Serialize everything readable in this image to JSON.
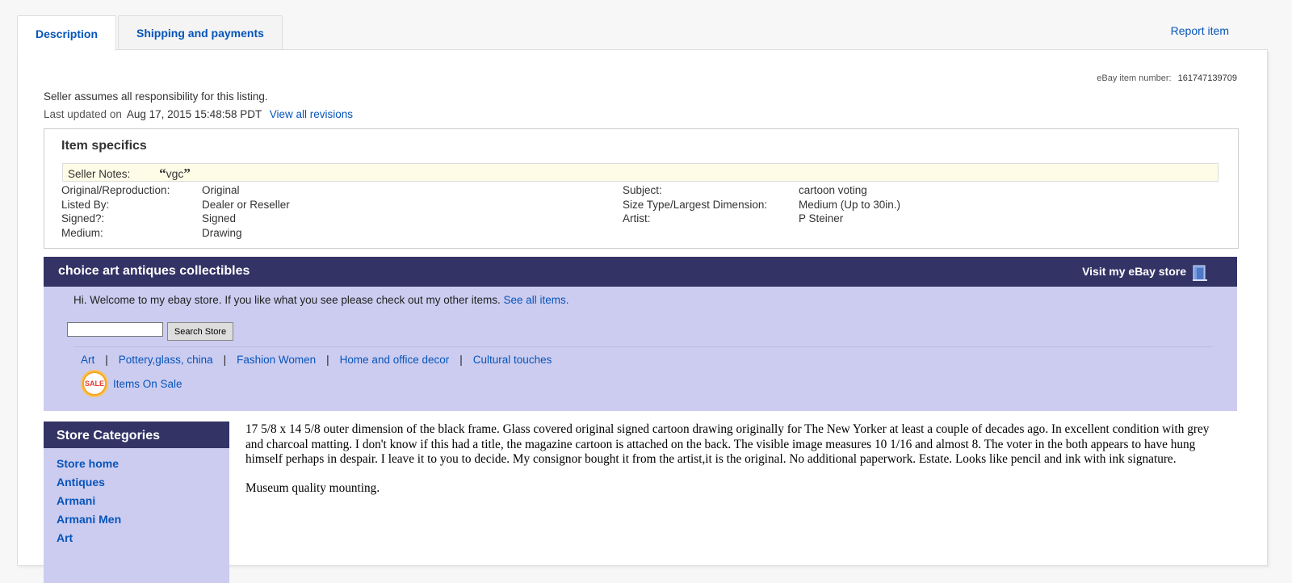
{
  "tabs": [
    {
      "label": "Description"
    },
    {
      "label": "Shipping and payments"
    }
  ],
  "report_label": "Report item",
  "item_number": {
    "label": "eBay item number:",
    "value": "161747139709"
  },
  "responsibility": "Seller assumes all responsibility for this listing.",
  "last_updated": {
    "label": "Last updated on",
    "value": "Aug 17, 2015 15:48:58 PDT",
    "link": "View all revisions"
  },
  "item_specifics": {
    "title": "Item specifics",
    "seller_notes": {
      "label": "Seller Notes:",
      "value": "vgc",
      "open_quote": "“",
      "close_quote": "”"
    },
    "left": [
      {
        "k": "Original/Reproduction:",
        "v": "Original"
      },
      {
        "k": "Listed By:",
        "v": "Dealer or Reseller"
      },
      {
        "k": "Signed?:",
        "v": "Signed"
      },
      {
        "k": "Medium:",
        "v": "Drawing"
      }
    ],
    "right": [
      {
        "k": "Subject:",
        "v": "cartoon voting"
      },
      {
        "k": "Size Type/Largest Dimension:",
        "v": "Medium (Up to 30in.)"
      },
      {
        "k": "Artist:",
        "v": "P Steiner"
      }
    ]
  },
  "store": {
    "name": "choice art antiques collectibles",
    "visit_label": "Visit my eBay store",
    "welcome": "Hi. Welcome to my ebay store. If you like what you see please check out my other items.",
    "see_all": "See all items.",
    "search_button": "Search Store",
    "search_value": "",
    "nav": [
      "Art",
      "Pottery,glass, china",
      "Fashion Women",
      "Home and office decor",
      "Cultural touches"
    ],
    "nav_separator": "|",
    "sale_badge": "SALE",
    "sale_label": "Items On Sale"
  },
  "store_categories": {
    "title": "Store Categories",
    "items": [
      "Store home",
      "Antiques",
      "Armani",
      "Armani Men",
      "Art"
    ]
  },
  "description": {
    "paragraphs": [
      "17 5/8 x 14 5/8 outer dimension of the black frame. Glass covered original signed cartoon drawing originally for The New Yorker at least a couple of decades ago. In excellent condition with grey and charcoal matting. I don't know if this had a title, the magazine cartoon is attached on the back. The visible image measures 10 1/16 and almost 8. The voter in the both appears to have hung himself perhaps in despair. I leave it to you to decide. My consignor bought it from the artist,it is the original. No additional paperwork. Estate. Looks like pencil and ink with ink signature.",
      "Museum quality mounting."
    ]
  },
  "colors": {
    "link": "#0654ba",
    "store_header": "#333366",
    "store_body": "#ccccf0",
    "notes_bg": "#fefbe6"
  }
}
